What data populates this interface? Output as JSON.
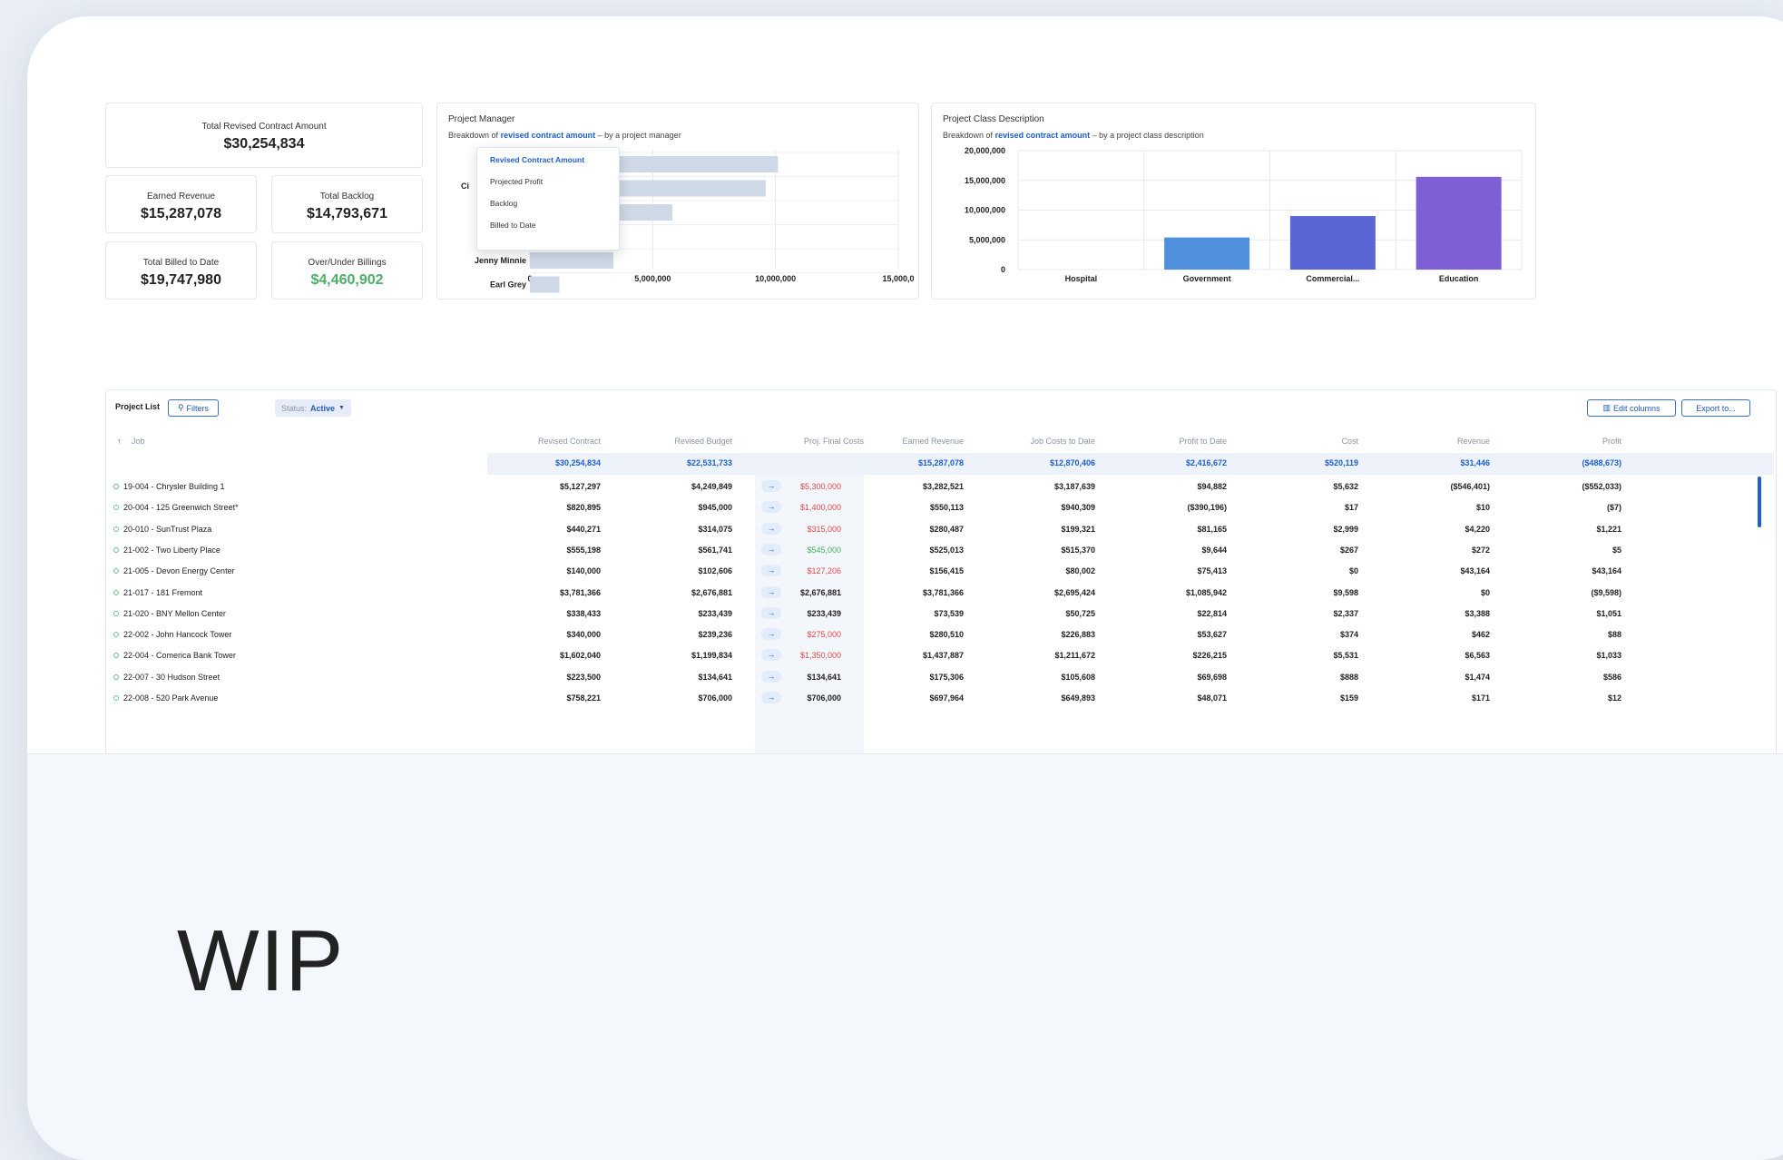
{
  "kpis": {
    "total_revised_contract_amount": {
      "label": "Total Revised Contract Amount",
      "value": "$30,254,834"
    },
    "earned_revenue": {
      "label": "Earned Revenue",
      "value": "$15,287,078"
    },
    "total_backlog": {
      "label": "Total Backlog",
      "value": "$14,793,671"
    },
    "total_billed_to_date": {
      "label": "Total Billed to Date",
      "value": "$19,747,980"
    },
    "over_under_billings": {
      "label": "Over/Under Billings",
      "value": "$4,460,902",
      "color": "#4caf6a"
    }
  },
  "pm_chart": {
    "title": "Project Manager",
    "subtitle_prefix": "Breakdown of",
    "subtitle_link": "revised contract amount",
    "subtitle_suffix": "by a project manager",
    "dropdown": [
      "Revised Contract Amount",
      "Projected Profit",
      "Backlog",
      "Billed to Date"
    ],
    "hidden_label_fragment": "Ci"
  },
  "class_chart": {
    "title": "Project Class Description",
    "subtitle_prefix": "Breakdown of",
    "subtitle_link": "revised contract amount",
    "subtitle_suffix": "by a project class description"
  },
  "chart_data": [
    {
      "type": "bar",
      "orientation": "horizontal",
      "categories": [
        "",
        "",
        "",
        "",
        "Jenny Minnie",
        "Earl Grey"
      ],
      "values": [
        10100000,
        9600000,
        5800000,
        3600000,
        3400000,
        1200000
      ],
      "xlim": [
        0,
        15000000
      ],
      "x_ticks": [
        "0",
        "5,000,000",
        "10,000,000",
        "15,000,0"
      ],
      "color": "#cfd8e6",
      "grid": true
    },
    {
      "type": "bar",
      "categories": [
        "Hospital",
        "Government",
        "Commercial...",
        "Education"
      ],
      "values": [
        0,
        5400000,
        9000000,
        15600000
      ],
      "ylim": [
        0,
        20000000
      ],
      "y_ticks": [
        "0",
        "5,000,000",
        "10,000,000",
        "15,000,000",
        "20,000,000"
      ],
      "colors": [
        "#4f8fdc",
        "#4f8fdc",
        "#5a66d6",
        "#7e5fd6"
      ],
      "grid": true
    }
  ],
  "table": {
    "toolbar": {
      "label": "Project List",
      "filters": "Filters",
      "status_label": "Status:",
      "status_value": "Active",
      "edit_columns": "Edit columns",
      "export": "Export to..."
    },
    "sort_glyph": "↑",
    "columns": [
      "Job",
      "Revised Contract",
      "Revised Budget",
      "Proj. Final Costs",
      "Earned Revenue",
      "Job Costs to Date",
      "Profit to Date",
      "Cost",
      "Revenue",
      "Profit"
    ],
    "totals": [
      "$30,254,834",
      "$22,531,733",
      "$15,287,078",
      "$12,870,406",
      "$2,416,672",
      "$520,119",
      "$31,446",
      "($488,673)"
    ],
    "rows": [
      {
        "job": "19-004 - Chrysler Building 1",
        "rc": "$5,127,297",
        "rb": "$4,249,849",
        "pfc": "$5,300,000",
        "pfc_color": "red",
        "er": "$3,282,521",
        "jc": "$3,187,639",
        "ptd": "$94,882",
        "cost": "$5,632",
        "rev": "($546,401)",
        "profit": "($552,033)"
      },
      {
        "job": "20-004 - 125 Greenwich Street*",
        "rc": "$820,895",
        "rb": "$945,000",
        "pfc": "$1,400,000",
        "pfc_color": "red",
        "er": "$550,113",
        "jc": "$940,309",
        "ptd": "($390,196)",
        "cost": "$17",
        "rev": "$10",
        "profit": "($7)"
      },
      {
        "job": "20-010 - SunTrust Plaza",
        "rc": "$440,271",
        "rb": "$314,075",
        "pfc": "$315,000",
        "pfc_color": "red",
        "er": "$280,487",
        "jc": "$199,321",
        "ptd": "$81,165",
        "cost": "$2,999",
        "rev": "$4,220",
        "profit": "$1,221"
      },
      {
        "job": "21-002 - Two Liberty Place",
        "rc": "$555,198",
        "rb": "$561,741",
        "pfc": "$545,000",
        "pfc_color": "green",
        "er": "$525,013",
        "jc": "$515,370",
        "ptd": "$9,644",
        "cost": "$267",
        "rev": "$272",
        "profit": "$5"
      },
      {
        "job": "21-005 - Devon Energy Center",
        "rc": "$140,000",
        "rb": "$102,606",
        "pfc": "$127,206",
        "pfc_color": "red",
        "er": "$156,415",
        "jc": "$80,002",
        "ptd": "$75,413",
        "cost": "$0",
        "rev": "$43,164",
        "profit": "$43,164"
      },
      {
        "job": "21-017 - 181 Fremont",
        "rc": "$3,781,366",
        "rb": "$2,676,881",
        "pfc": "$2,676,881",
        "pfc_color": "black",
        "er": "$3,781,366",
        "jc": "$2,695,424",
        "ptd": "$1,085,942",
        "cost": "$9,598",
        "rev": "$0",
        "profit": "($9,598)"
      },
      {
        "job": "21-020 - BNY Mellon Center",
        "rc": "$338,433",
        "rb": "$233,439",
        "pfc": "$233,439",
        "pfc_color": "black",
        "er": "$73,539",
        "jc": "$50,725",
        "ptd": "$22,814",
        "cost": "$2,337",
        "rev": "$3,388",
        "profit": "$1,051"
      },
      {
        "job": "22-002 - John Hancock Tower",
        "rc": "$340,000",
        "rb": "$239,236",
        "pfc": "$275,000",
        "pfc_color": "red",
        "er": "$280,510",
        "jc": "$226,883",
        "ptd": "$53,627",
        "cost": "$374",
        "rev": "$462",
        "profit": "$88"
      },
      {
        "job": "22-004 - Comerica Bank Tower",
        "rc": "$1,602,040",
        "rb": "$1,199,834",
        "pfc": "$1,350,000",
        "pfc_color": "red",
        "er": "$1,437,887",
        "jc": "$1,211,672",
        "ptd": "$226,215",
        "cost": "$5,531",
        "rev": "$6,563",
        "profit": "$1,033"
      },
      {
        "job": "22-007 - 30 Hudson Street",
        "rc": "$223,500",
        "rb": "$134,641",
        "pfc": "$134,641",
        "pfc_color": "black",
        "er": "$175,306",
        "jc": "$105,608",
        "ptd": "$69,698",
        "cost": "$888",
        "rev": "$1,474",
        "profit": "$586"
      },
      {
        "job": "22-008 - 520 Park Avenue",
        "rc": "$758,221",
        "rb": "$706,000",
        "pfc": "$706,000",
        "pfc_color": "black",
        "er": "$697,964",
        "jc": "$649,893",
        "ptd": "$48,071",
        "cost": "$159",
        "rev": "$171",
        "profit": "$12"
      }
    ]
  },
  "footer": {
    "title": "WIP"
  }
}
